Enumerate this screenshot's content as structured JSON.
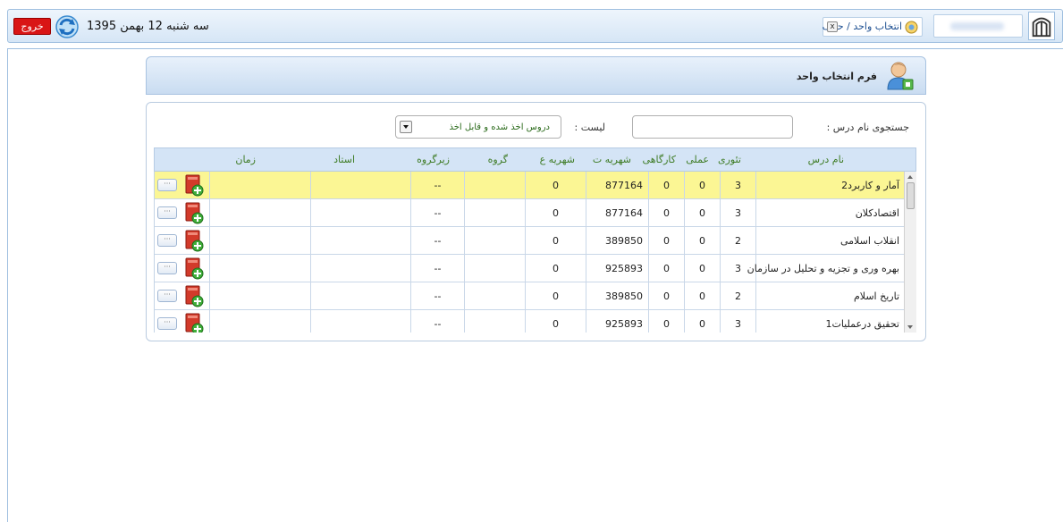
{
  "topbar": {
    "exit_label": "خروج",
    "date_text": "سه شنبه 12 بهمن 1395",
    "tab_label": "انتخاب واحد / حذف",
    "tab_close": "x"
  },
  "form": {
    "title": "فرم انتخاب واحد",
    "search_label": "جستجوی نام درس :",
    "search_value": "",
    "list_label": "لیست :",
    "list_value": "دروس اخذ شده و قابل اخذ"
  },
  "grid": {
    "headers": {
      "name": "نام درس",
      "theory": "تئوری",
      "practical": "عملی",
      "workshop": "کارگاهی",
      "tuition_t": "شهریه ت",
      "tuition_a": "شهریه ع",
      "group": "گروه",
      "subgroup": "زیرگروه",
      "teacher": "استاد",
      "time": "زمان"
    },
    "rows": [
      {
        "name": "آمار و کاربرد2",
        "theory": "3",
        "practical": "0",
        "workshop": "0",
        "tuition_t": "877164",
        "tuition_a": "0",
        "group": "",
        "subgroup": "--",
        "teacher": "",
        "time": "",
        "selected": true
      },
      {
        "name": "اقتصادکلان",
        "theory": "3",
        "practical": "0",
        "workshop": "0",
        "tuition_t": "877164",
        "tuition_a": "0",
        "group": "",
        "subgroup": "--",
        "teacher": "",
        "time": ""
      },
      {
        "name": "انقلاب اسلامی",
        "theory": "2",
        "practical": "0",
        "workshop": "0",
        "tuition_t": "389850",
        "tuition_a": "0",
        "group": "",
        "subgroup": "--",
        "teacher": "",
        "time": ""
      },
      {
        "name": "بهره وری و تجزیه و تحلیل در سازمان",
        "theory": "3",
        "practical": "0",
        "workshop": "0",
        "tuition_t": "925893",
        "tuition_a": "0",
        "group": "",
        "subgroup": "--",
        "teacher": "",
        "time": ""
      },
      {
        "name": "تاریخ اسلام",
        "theory": "2",
        "practical": "0",
        "workshop": "0",
        "tuition_t": "389850",
        "tuition_a": "0",
        "group": "",
        "subgroup": "--",
        "teacher": "",
        "time": ""
      },
      {
        "name": "تحقیق درعملیات1",
        "theory": "3",
        "practical": "0",
        "workshop": "0",
        "tuition_t": "925893",
        "tuition_a": "0",
        "group": "",
        "subgroup": "--",
        "teacher": "",
        "time": ""
      }
    ],
    "dots_label": "···"
  },
  "colors": {
    "accent_blue": "#d4e4f6",
    "selected_row": "#fbf694",
    "exit_red": "#d91515",
    "header_text_green": "#3f7c26"
  },
  "icons": [
    "refresh-icon",
    "university-logo-icon",
    "lesson-tab-icon",
    "close-icon",
    "user-icon",
    "add-course-icon",
    "more-options-icon"
  ]
}
